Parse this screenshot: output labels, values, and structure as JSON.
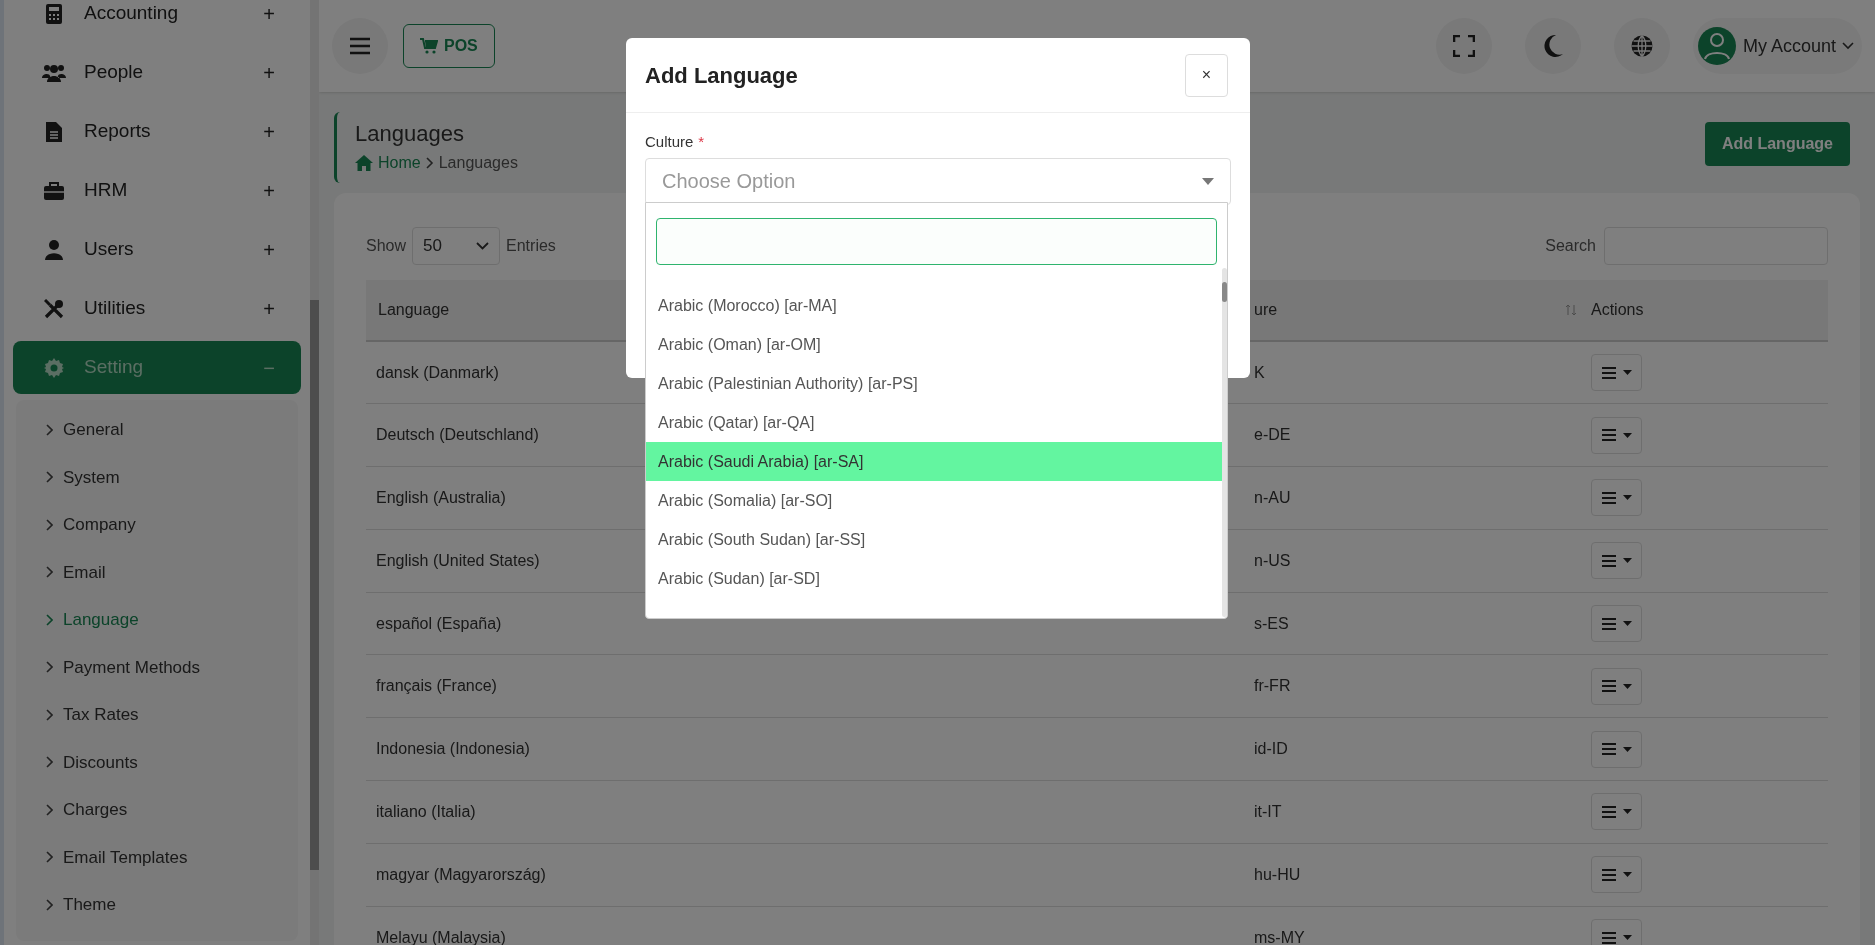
{
  "sidebar": {
    "items": [
      {
        "label": "Accounting",
        "toggle": "+",
        "selected": false
      },
      {
        "label": "People",
        "toggle": "+",
        "selected": false
      },
      {
        "label": "Reports",
        "toggle": "+",
        "selected": false
      },
      {
        "label": "HRM",
        "toggle": "+",
        "selected": false
      },
      {
        "label": "Users",
        "toggle": "+",
        "selected": false
      },
      {
        "label": "Utilities",
        "toggle": "+",
        "selected": false
      },
      {
        "label": "Setting",
        "toggle": "−",
        "selected": true,
        "children": [
          {
            "label": "General",
            "selected": false
          },
          {
            "label": "System",
            "selected": false
          },
          {
            "label": "Company",
            "selected": false
          },
          {
            "label": "Email",
            "selected": false
          },
          {
            "label": "Language",
            "selected": true
          },
          {
            "label": "Payment Methods",
            "selected": false
          },
          {
            "label": "Tax Rates",
            "selected": false
          },
          {
            "label": "Discounts",
            "selected": false
          },
          {
            "label": "Charges",
            "selected": false
          },
          {
            "label": "Email Templates",
            "selected": false
          },
          {
            "label": "Theme",
            "selected": false
          }
        ]
      }
    ]
  },
  "top_bar": {
    "pos_button": "POS",
    "account": "My Account"
  },
  "page_header": {
    "title": "Languages",
    "breadcrumb": [
      "Home",
      "Languages"
    ],
    "add_button": "Add Language"
  },
  "table_controls": {
    "show_label": "Show",
    "page_size": "50",
    "entries_label": "Entries",
    "search_label": "Search"
  },
  "table": {
    "columns": [
      "Language",
      "ure",
      "Actions"
    ],
    "rows": [
      {
        "language": "dansk (Danmark)",
        "culture": "K"
      },
      {
        "language": "Deutsch (Deutschland)",
        "culture": "e-DE"
      },
      {
        "language": "English (Australia)",
        "culture": "n-AU"
      },
      {
        "language": "English (United States)",
        "culture": "n-US"
      },
      {
        "language": "español (España)",
        "culture": "s-ES"
      },
      {
        "language": "français (France)",
        "culture": "fr-FR"
      },
      {
        "language": "Indonesia (Indonesia)",
        "culture": "id-ID"
      },
      {
        "language": "italiano (Italia)",
        "culture": "it-IT"
      },
      {
        "language": "magyar (Magyarország)",
        "culture": "hu-HU"
      },
      {
        "language": "Melayu (Malaysia)",
        "culture": "ms-MY"
      }
    ]
  },
  "dialog": {
    "title": "Add Language",
    "close": "×",
    "field_label": "Culture",
    "required_mark": "*",
    "placeholder": "Choose Option",
    "options": [
      {
        "label": "Arabic (Morocco) [ar-MA]",
        "selected": false
      },
      {
        "label": "Arabic (Oman) [ar-OM]",
        "selected": false
      },
      {
        "label": "Arabic (Palestinian Authority) [ar-PS]",
        "selected": false
      },
      {
        "label": "Arabic (Qatar) [ar-QA]",
        "selected": false
      },
      {
        "label": "Arabic (Saudi Arabia) [ar-SA]",
        "selected": true
      },
      {
        "label": "Arabic (Somalia) [ar-SO]",
        "selected": false
      },
      {
        "label": "Arabic (South Sudan) [ar-SS]",
        "selected": false
      },
      {
        "label": "Arabic (Sudan) [ar-SD]",
        "selected": false
      }
    ]
  }
}
